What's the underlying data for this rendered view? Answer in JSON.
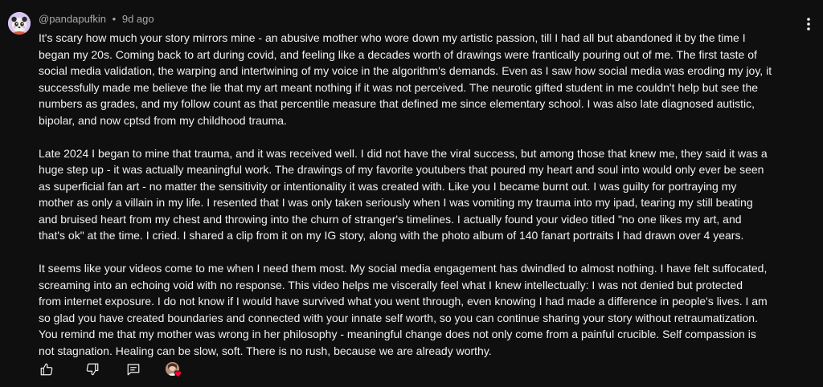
{
  "comment": {
    "author_handle": "@pandapufkin",
    "separator": "•",
    "timestamp": "9d ago",
    "paragraphs": [
      [
        "It's scary how much your story mirrors mine - an abusive mother who wore down my artistic passion, till I had all but abandoned it by the time I",
        "began my 20s. Coming back to art during covid, and feeling like a decades worth of drawings were frantically pouring out of me. The first taste of",
        "social media validation, the warping and intertwining of my voice in the algorithm's demands. Even as I saw how social media was eroding my joy, it",
        "successfully made me believe the lie that my art meant nothing if it was not perceived. The neurotic gifted student in me couldn't help but see the",
        "numbers as grades, and my follow count as that percentile measure that defined me since elementary school.  I was also late diagnosed autistic,",
        "bipolar, and now cptsd from my childhood trauma."
      ],
      [
        "Late 2024 I began to mine that trauma, and it was received well. I did not have the viral success, but among those that knew me, they said it was a",
        "huge step up - it was actually meaningful work. The drawings of my favorite youtubers that poured my heart and soul into would only ever be seen",
        "as superficial fan art - no matter the sensitivity or intentionality it was created with. Like you I became burnt out. I was guilty for portraying my",
        "mother as only a villain in my life. I resented that I was only taken seriously when I was vomiting my trauma into my ipad, tearing my still beating",
        "and bruised heart from my chest and throwing into the churn of stranger's timelines. I actually found your video titled \"no one likes my art, and",
        "that's ok\" at the time. I cried. I shared a clip from it on my IG story, along with the photo album of 140 fanart portraits I had drawn over 4 years."
      ],
      [
        "It seems like your videos come to me when I need them most. My social media engagement has dwindled to almost nothing. I have felt suffocated,",
        "screaming into an echoing void with no response. This video helps me viscerally feel what I knew intellectually:  I was not denied but protected",
        "from internet exposure. I do not know if I would have survived what you went through, even knowing I had made a difference in people's lives. I am",
        "so glad you have created boundaries and connected with your innate self worth, so you can continue sharing your story without retraumatization.",
        "You remind me that my mother was wrong in her philosophy - meaningful change does not only come from a painful crucible. Self compassion is",
        "not stagnation. Healing can be slow, soft. There is no rush, because we are already worthy."
      ]
    ]
  },
  "icons": {
    "avatar": "panda-avatar",
    "menu": "more-vert-icon",
    "like": "thumbs-up-icon",
    "dislike": "thumbs-down-icon",
    "reply": "comment-reply-icon",
    "creator_heart": "creator-heart-icon"
  },
  "colors": {
    "background": "#0f0f0f",
    "text": "#f1f1f1",
    "meta": "#aaaaaa",
    "heart": "#ff0033"
  }
}
